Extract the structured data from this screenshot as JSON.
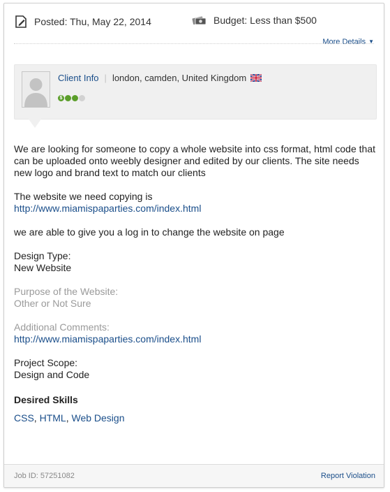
{
  "header": {
    "posted_label": "Posted: Thu, May 22, 2014",
    "budget_label": "Budget: Less than $500",
    "more_details": "More Details"
  },
  "client": {
    "info_label": "Client Info",
    "location": "london, camden, United Kingdom",
    "flag_icon": "uk-flag-icon",
    "rating_dots": {
      "filled": 3,
      "total": 4,
      "first_symbol": "$"
    }
  },
  "description": {
    "intro": "We are looking for someone to copy a whole website into css format, html code that can be uploaded onto weebly designer and edited by our clients. The site needs new logo and brand text to match our clients",
    "copy_label": "The website we need copying is",
    "copy_url": "http://www.miamispaparties.com/index.html",
    "login_note": "we are able to give you a log in to change the website on page",
    "design_type_label": "Design Type:",
    "design_type_value": "New Website",
    "purpose_label": "Purpose of the Website:",
    "purpose_value": "Other or Not Sure",
    "comments_label": "Additional Comments:",
    "comments_url": "http://www.miamispaparties.com/index.html",
    "scope_label": "Project Scope:",
    "scope_value": "Design and Code"
  },
  "skills": {
    "heading": "Desired Skills",
    "items": [
      "CSS",
      "HTML",
      "Web Design"
    ]
  },
  "footer": {
    "job_id": "Job ID: 57251082",
    "report": "Report Violation"
  },
  "colors": {
    "link": "#1a4e8a",
    "muted": "#9a9a9a",
    "rating_green": "#5b9e2a",
    "client_box_bg": "#f0f0f0"
  }
}
